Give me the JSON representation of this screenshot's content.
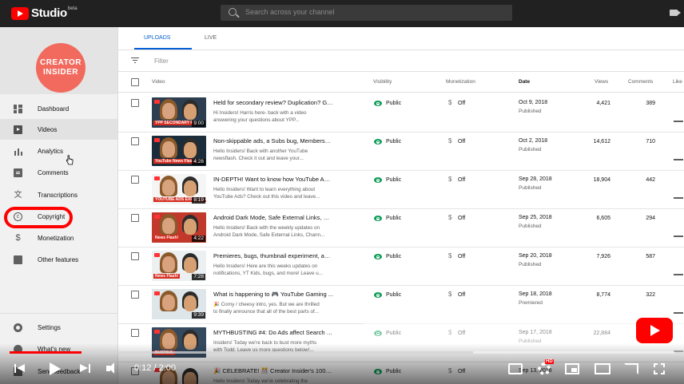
{
  "app": {
    "name": "Studio",
    "badge": "beta"
  },
  "search": {
    "placeholder": "Search across your channel"
  },
  "channel": {
    "name_line1": "CREATOR",
    "name_line2": "INSIDER"
  },
  "sidebar": {
    "items": [
      {
        "label": "Dashboard",
        "icon": "dashboard-icon"
      },
      {
        "label": "Videos",
        "icon": "videos-icon"
      },
      {
        "label": "Analytics",
        "icon": "analytics-icon"
      },
      {
        "label": "Comments",
        "icon": "comments-icon"
      },
      {
        "label": "Transcriptions",
        "icon": "translate-icon"
      },
      {
        "label": "Copyright",
        "icon": "copyright-icon"
      },
      {
        "label": "Monetization",
        "icon": "dollar-icon"
      },
      {
        "label": "Other features",
        "icon": "folder-icon"
      }
    ],
    "bottom": [
      {
        "label": "Settings",
        "icon": "gear-icon"
      },
      {
        "label": "What's new",
        "icon": "alert-icon"
      },
      {
        "label": "Send feedback",
        "icon": "feedback-icon"
      }
    ],
    "highlighted": "Copyright",
    "highlight_color": "#ff0000"
  },
  "tabs": [
    {
      "label": "UPLOADS",
      "active": true
    },
    {
      "label": "LIVE",
      "active": false
    }
  ],
  "filter": {
    "label": "Filter"
  },
  "columns": {
    "video": "Video",
    "visibility": "Visibility",
    "monetization": "Monetization",
    "date": "Date",
    "views": "Views",
    "comments": "Comments",
    "likes": "Like"
  },
  "rows": [
    {
      "title": "Held for secondary review? Duplication? Get...",
      "desc1": "Hi Insiders! Harris here- back with a video",
      "desc2": "answering your questions about YPP...",
      "duration": "9:00",
      "caption": "YPP SECONDARY R",
      "visibility": "Public",
      "monetization": "Off",
      "date": "Oct 9, 2018",
      "status": "Published",
      "views": "4,421",
      "comments": "389"
    },
    {
      "title": "Non-skippable ads, a Subs bug, Membershi...",
      "desc1": "Hello Insiders! Back with another YouTube",
      "desc2": "newsflash. Check it out and leave your...",
      "duration": "4:28",
      "caption": "YouTube News Flash!",
      "visibility": "Public",
      "monetization": "Off",
      "date": "Oct 2, 2018",
      "status": "Published",
      "views": "14,612",
      "comments": "710"
    },
    {
      "title": "IN-DEPTH! Want to know how YouTube Ads ...",
      "desc1": "Hello Insiders! Want to learn everything about",
      "desc2": "YouTube Ads? Check out this video and leave...",
      "duration": "8:19",
      "caption": "YOUTUBE ADS EXPLAINED",
      "visibility": "Public",
      "monetization": "Off",
      "date": "Sep 28, 2018",
      "status": "Published",
      "views": "18,904",
      "comments": "442"
    },
    {
      "title": "Android Dark Mode, Safe External Links, Cha...",
      "desc1": "Hello Insiders! Back with the weekly updates on",
      "desc2": "Android Dark Mode, Safe External Links, Chann...",
      "duration": "4:22",
      "caption": "News Flash!",
      "visibility": "Public",
      "monetization": "Off",
      "date": "Sep 25, 2018",
      "status": "Published",
      "views": "6,605",
      "comments": "294"
    },
    {
      "title": "Premieres, bugs, thumbnail experiment, and ...",
      "desc1": "Hello Insiders! Here are this weeks updates on",
      "desc2": "notifications, YT Kids, bugs, and more! Leave u...",
      "duration": "7:28",
      "caption": "News Flash!",
      "visibility": "Public",
      "monetization": "Off",
      "date": "Sep 20, 2018",
      "status": "Published",
      "views": "7,926",
      "comments": "587"
    },
    {
      "title": "What is happening to 🎮 YouTube Gaming ...",
      "desc1": "🎉 Corny / cheesy intro, yes. But we are thrilled",
      "desc2": "to finally announce that all of the best parts of...",
      "duration": "9:39",
      "caption": "",
      "visibility": "Public",
      "monetization": "Off",
      "date": "Sep 18, 2018",
      "status": "Premiered",
      "views": "8,774",
      "comments": "322"
    },
    {
      "title": "MYTHBUSTING #4: Do Ads affect Search & ...",
      "desc1": "Insiders! Today we're back to bust more myths",
      "desc2": "with Todd. Leave us more questions below!...",
      "duration": "",
      "caption": "BUSTING",
      "visibility": "Public",
      "monetization": "Off",
      "date": "Sep 17, 2018",
      "status": "Published",
      "views": "22,884",
      "comments": "1,3"
    },
    {
      "title": "🎉 CELEBRATE! 🎊 Creator Insider's 100th vi...",
      "desc1": "Hello Insiders! Today we're celebrating the",
      "desc2": "",
      "duration": "",
      "caption": "",
      "visibility": "Public",
      "monetization": "Off",
      "date": "Sep 13, 2018",
      "status": "",
      "views": "",
      "comments": ""
    }
  ],
  "player": {
    "time": "0:12 / 2:00",
    "quality_badge": "HD",
    "progress": 0.108,
    "accent": "#ff0000"
  }
}
